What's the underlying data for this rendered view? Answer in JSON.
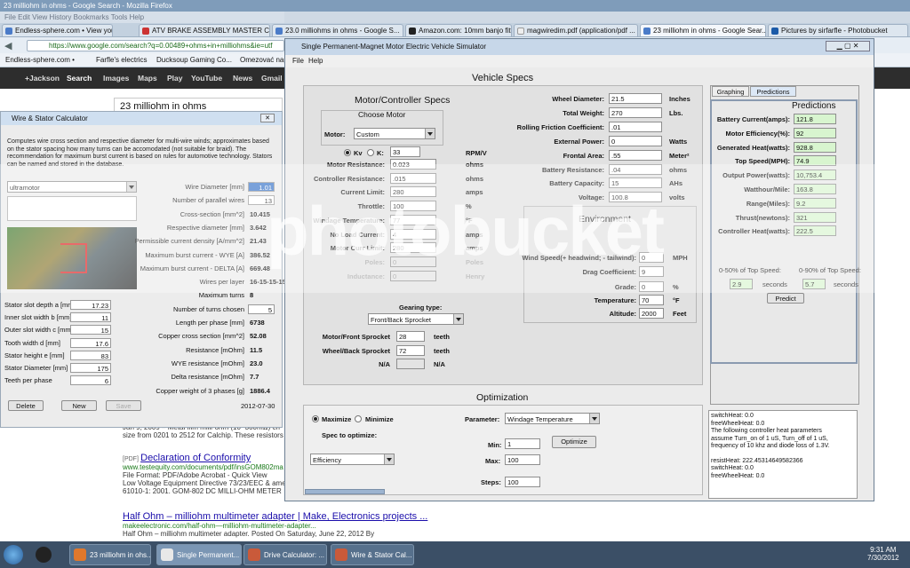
{
  "firefox": {
    "title": "23 milliohm in ohms - Google Search - Mozilla Firefox",
    "menu": "File   Edit   View   History   Bookmarks   Tools   Help",
    "tabs": [
      "Endless-sphere.com • View your p...",
      "ATV BRAKE ASSEMBLY MASTER C...",
      "23.0 milliohms in ohms - Google S...",
      "Amazon.com: 10mm banjo fitting ...",
      "magwiredim.pdf (application/pdf ...",
      "23 milliohm in ohms - Google Sear...",
      "Pictures by sirfarfle - Photobucket"
    ],
    "url": "https://www.google.com/search?q=0.00489+ohms+in+milliohms&ie=utf",
    "bookmarks": [
      "Endless-sphere.com •",
      "Farfle's electrics",
      "Ducksoup Gaming Co...",
      "Omezovać nap..."
    ]
  },
  "google": {
    "nav": [
      "+Jackson",
      "Search",
      "Images",
      "Maps",
      "Play",
      "YouTube",
      "News",
      "Gmail"
    ],
    "query": "23 milliohm in ohms",
    "results": [
      {
        "snippet": "Jan 9, 2009 – Metal film milli-ohm (10~300mΩ) ch",
        "snippet2": "size from 0201 to 2512 for Calchip. These resistors"
      },
      {
        "tag": "[PDF]",
        "title": "Declaration of Conformity",
        "url": "www.testequity.com/documents/pdf/insGOM802ma",
        "line1": "File Format: PDF/Adobe Acrobat - Quick View",
        "line2": "Low Voltage Equipment Directive 73/23/EEC & ame",
        "line3": "61010-1: 2001. GOM-802 DC MILLI-OHM METER"
      },
      {
        "title": "Half Ohm – milliohm multimeter adapter | Make, Electronics projects ...",
        "url": "makeelectronic.com/half-ohm—milliohm-multimeter-adapter...",
        "line1": "Half Ohm – milliohm multimeter adapter. Posted On Saturday, June 22, 2012 By"
      }
    ]
  },
  "wire": {
    "title": "Wire & Stator Calculator",
    "desc": "Computes wire cross section and respective diameter for multi-wire winds; approximates based on the stator spacing how many turns can be accomodated (not suitable for braid). The recommendation for maximum burst current is based on rules for automotive technology. Stators can be named and stored in the database.",
    "motor": "ultramotor",
    "left": [
      [
        "Stator slot depth a [mm]",
        "17.23"
      ],
      [
        "Inner slot width b [mm]",
        "11"
      ],
      [
        "Outer slot width c [mm]",
        "15"
      ],
      [
        "Tooth width d [mm]",
        "17.6"
      ],
      [
        "Stator height e [mm]",
        "83"
      ],
      [
        "Stator Diameter [mm]",
        "175"
      ],
      [
        "Teeth per phase",
        "6"
      ]
    ],
    "right": [
      [
        "Wire Diameter [mm]",
        "1.01"
      ],
      [
        "Number of parallel wires",
        "13"
      ],
      [
        "Cross-section [mm^2]",
        "10.415"
      ],
      [
        "Respective diameter [mm]",
        "3.642"
      ],
      [
        "Permissible current density [A/mm^2]",
        "21.43"
      ],
      [
        "Maximum burst current - WYE [A]",
        "386.52"
      ],
      [
        "Maximum burst current - DELTA [A]",
        "669.48"
      ],
      [
        "Wires per layer",
        "16-15-15-15-15-10"
      ],
      [
        "Maximum turns",
        "8"
      ],
      [
        "Number of turns chosen",
        "5"
      ],
      [
        "Length per phase [mm]",
        "6738"
      ],
      [
        "Copper cross section [mm^2]",
        "52.08"
      ],
      [
        "Resistance [mOhm]",
        "11.5"
      ],
      [
        "WYE resistance [mOhm]",
        "23.0"
      ],
      [
        "Delta resistance [mOhm]",
        "7.7"
      ],
      [
        "Copper weight of 3 phases [g]",
        "1886.4"
      ]
    ],
    "delete": "Delete",
    "new": "New",
    "save": "Save",
    "date": "2012-07-30"
  },
  "sim": {
    "title": "Single Permanent-Magnet Motor Electric Vehicle Simulator",
    "menu_file": "File",
    "menu_help": "Help",
    "header": "Vehicle Specs",
    "motor_title": "Motor/Controller Specs",
    "choose": "Choose Motor",
    "motor_lbl": "Motor:",
    "motor_val": "Custom",
    "kv": "Kv",
    "k": "K:",
    "kv_val": "33",
    "kv_unit": "RPM/V",
    "motor_fields": [
      [
        "Motor Resistance:",
        "0.023",
        "ohms"
      ],
      [
        "Controller Resistance:",
        ".015",
        "ohms"
      ],
      [
        "Current Limit:",
        "280",
        "amps"
      ],
      [
        "Throttle:",
        "100",
        "%"
      ],
      [
        "Windage Temperature:",
        "77",
        "°F"
      ],
      [
        "No Load Current:",
        "4",
        "amps"
      ],
      [
        "Motor Curr Limit:",
        "280",
        "amps"
      ],
      [
        "Poles:",
        "0",
        "Poles"
      ],
      [
        "Inductance:",
        "0",
        "Henry"
      ]
    ],
    "gearing_lbl": "Gearing type:",
    "gearing_val": "Front/Back Sprocket",
    "gear_fields": [
      [
        "Motor/Front Sprocket",
        "28",
        "teeth"
      ],
      [
        "Wheel/Back Sprocket",
        "72",
        "teeth"
      ],
      [
        "N/A",
        "",
        "N/A"
      ]
    ],
    "vehicle_fields": [
      [
        "Wheel Diameter:",
        "21.5",
        "Inches"
      ],
      [
        "Total Weight:",
        "270",
        "Lbs."
      ],
      [
        "Rolling Friction Coefficient:",
        ".01",
        ""
      ],
      [
        "External Power:",
        "0",
        "Watts"
      ],
      [
        "Frontal Area:",
        ".55",
        "Meter²"
      ],
      [
        "Battery Resistance:",
        ".04",
        "ohms"
      ],
      [
        "Battery Capacity:",
        "15",
        "AHs"
      ],
      [
        "Voltage:",
        "100.8",
        "volts"
      ]
    ],
    "env_title": "Environment",
    "env_fields": [
      [
        "Wind Speed(+ headwind; - tailwind):",
        "0",
        "MPH"
      ],
      [
        "Drag Coefficient:",
        "9",
        ""
      ],
      [
        "Grade:",
        "0",
        "%"
      ],
      [
        "Temperature:",
        "70",
        "°F"
      ],
      [
        "Altitude:",
        "2000",
        "Feet"
      ]
    ],
    "tab_graphing": "Graphing",
    "tab_predictions": "Predictions",
    "pred_title": "Predictions",
    "pred": [
      [
        "Battery Current(amps):",
        "121.8"
      ],
      [
        "Motor Efficiency(%):",
        "92"
      ],
      [
        "Generated Heat(watts):",
        "928.8"
      ],
      [
        "Top Speed(MPH):",
        "74.9"
      ],
      [
        "Output Power(watts):",
        "10,753.4"
      ],
      [
        "Watthour/Mile:",
        "163.8"
      ],
      [
        "Range(Miles):",
        "9.2"
      ],
      [
        "Thrust(newtons):",
        "321"
      ],
      [
        "Controller Heat(watts):",
        "222.5"
      ]
    ],
    "speed50": "0-50% of Top Speed:",
    "speed90": "0-90% of Top Speed:",
    "s50": "2.9",
    "s90": "5.7",
    "seconds": "seconds",
    "predict": "Predict",
    "opt_title": "Optimization",
    "maximize": "Maximize",
    "minimize": "Minimize",
    "spec_lbl": "Spec to optimize:",
    "spec_val": "Efficiency",
    "param_lbl": "Parameter:",
    "param_val": "Windage Temperature",
    "min_lbl": "Min:",
    "min_val": "1",
    "max_lbl": "Max:",
    "max_val": "100",
    "steps_lbl": "Steps:",
    "steps_val": "100",
    "optimize": "Optimize",
    "log": [
      "switchHeat: 0.0",
      "freeWheelHeat: 0.0",
      "The following controller heat parameters",
      "assume Turn_on of 1 uS, Turn_off of 1 uS,",
      "frequency of 10 khz and diode loss of 1.3V.",
      "",
      "resistHeat: 222.45314649582366",
      "switchHeat: 0.0",
      "freeWheelHeat: 0.0"
    ]
  },
  "watermark": "photobucket",
  "taskbar": {
    "items": [
      "23 milliohm in ohs...",
      "Single Permanent...",
      "Drive Calculator: ...",
      "Wire & Stator Cal..."
    ],
    "time": "9:31 AM",
    "date": "7/30/2012"
  }
}
